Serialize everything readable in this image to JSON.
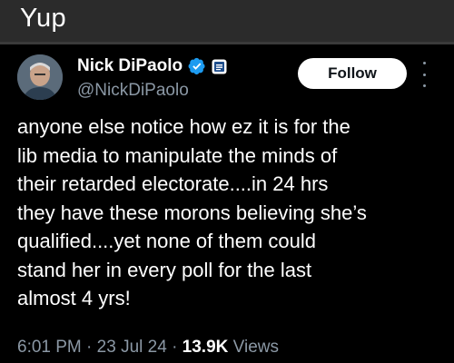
{
  "caption": "Yup",
  "tweet": {
    "author_name": "Nick DiPaolo",
    "author_handle": "@NickDiPaolo",
    "follow_label": "Follow",
    "text": "anyone else notice how ez it is for the\nlib media to manipulate the minds of\ntheir retarded electorate....in 24 hrs\nthey have these morons believing she’s\nqualified....yet none of them could\nstand her in every poll for the last\nalmost 4 yrs!",
    "time": "6:01 PM",
    "date": "23 Jul 24",
    "views_count": "13.9K",
    "views_label": "Views",
    "separator": "·"
  },
  "icons": {
    "verified": "verified-badge-icon",
    "affiliate": "affiliate-badge-icon",
    "more": "more-options-icon"
  },
  "colors": {
    "verified_blue": "#1d9bf0",
    "muted_text": "#8b98a5",
    "background": "#000000"
  }
}
